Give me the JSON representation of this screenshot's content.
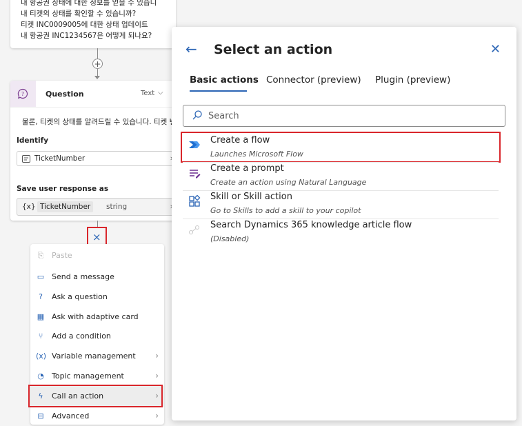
{
  "canvas": {
    "sample_lines": [
      "내 항공권 상태에 대한 정보를 얻을 수 있습니",
      "내 티켓의 상태를 확인할 수 있습니까?",
      "티켓 INC0009005에 대한 상태 업데이트",
      "내 항공권 INC1234567은 어떻게 되나요?"
    ],
    "add_node_label": "+",
    "question_node": {
      "title": "Question",
      "type_label": "Text",
      "message": "물론, 티켓의 상태를 알려드릴 수 있습니다. 티켓 번호",
      "identify_label": "Identify",
      "identify_value": "TicketNumber",
      "save_label": "Save user response as",
      "variable_icon": "{x}",
      "variable_name": "TicketNumber",
      "variable_type": "string"
    },
    "close_add_label": "×"
  },
  "add_menu": {
    "items": [
      {
        "label": "Paste",
        "icon": "paste-icon",
        "disabled": true
      },
      {
        "label": "Send a message",
        "icon": "message-icon"
      },
      {
        "label": "Ask a question",
        "icon": "question-icon"
      },
      {
        "label": "Ask with adaptive card",
        "icon": "adaptive-card-icon"
      },
      {
        "label": "Add a condition",
        "icon": "condition-icon"
      },
      {
        "label": "Variable management",
        "icon": "variable-icon",
        "submenu": true
      },
      {
        "label": "Topic management",
        "icon": "topic-icon",
        "submenu": true
      },
      {
        "label": "Call an action",
        "icon": "action-icon",
        "submenu": true,
        "highlighted": true
      },
      {
        "label": "Advanced",
        "icon": "advanced-icon",
        "submenu": true
      }
    ]
  },
  "panel": {
    "title": "Select an action",
    "tabs": [
      {
        "label": "Basic actions",
        "active": true
      },
      {
        "label": "Connector (preview)"
      },
      {
        "label": "Plugin (preview)"
      }
    ],
    "search_placeholder": "Search",
    "actions": [
      {
        "title": "Create a flow",
        "subtitle": "Launches Microsoft Flow",
        "icon": "power-automate-icon",
        "highlighted": true
      },
      {
        "title": "Create a prompt",
        "subtitle": "Create an action using Natural Language",
        "icon": "prompt-icon"
      },
      {
        "title": "Skill or Skill action",
        "subtitle": "Go to Skills to add a skill to your copilot",
        "icon": "skill-icon"
      },
      {
        "title": "Search Dynamics 365 knowledge article flow",
        "subtitle": "(Disabled)",
        "icon": "flow-disabled-icon"
      }
    ]
  },
  "colors": {
    "accent": "#2b65b5",
    "highlight_border": "#d9262b",
    "question_icon_bg": "#f0e8f3"
  }
}
